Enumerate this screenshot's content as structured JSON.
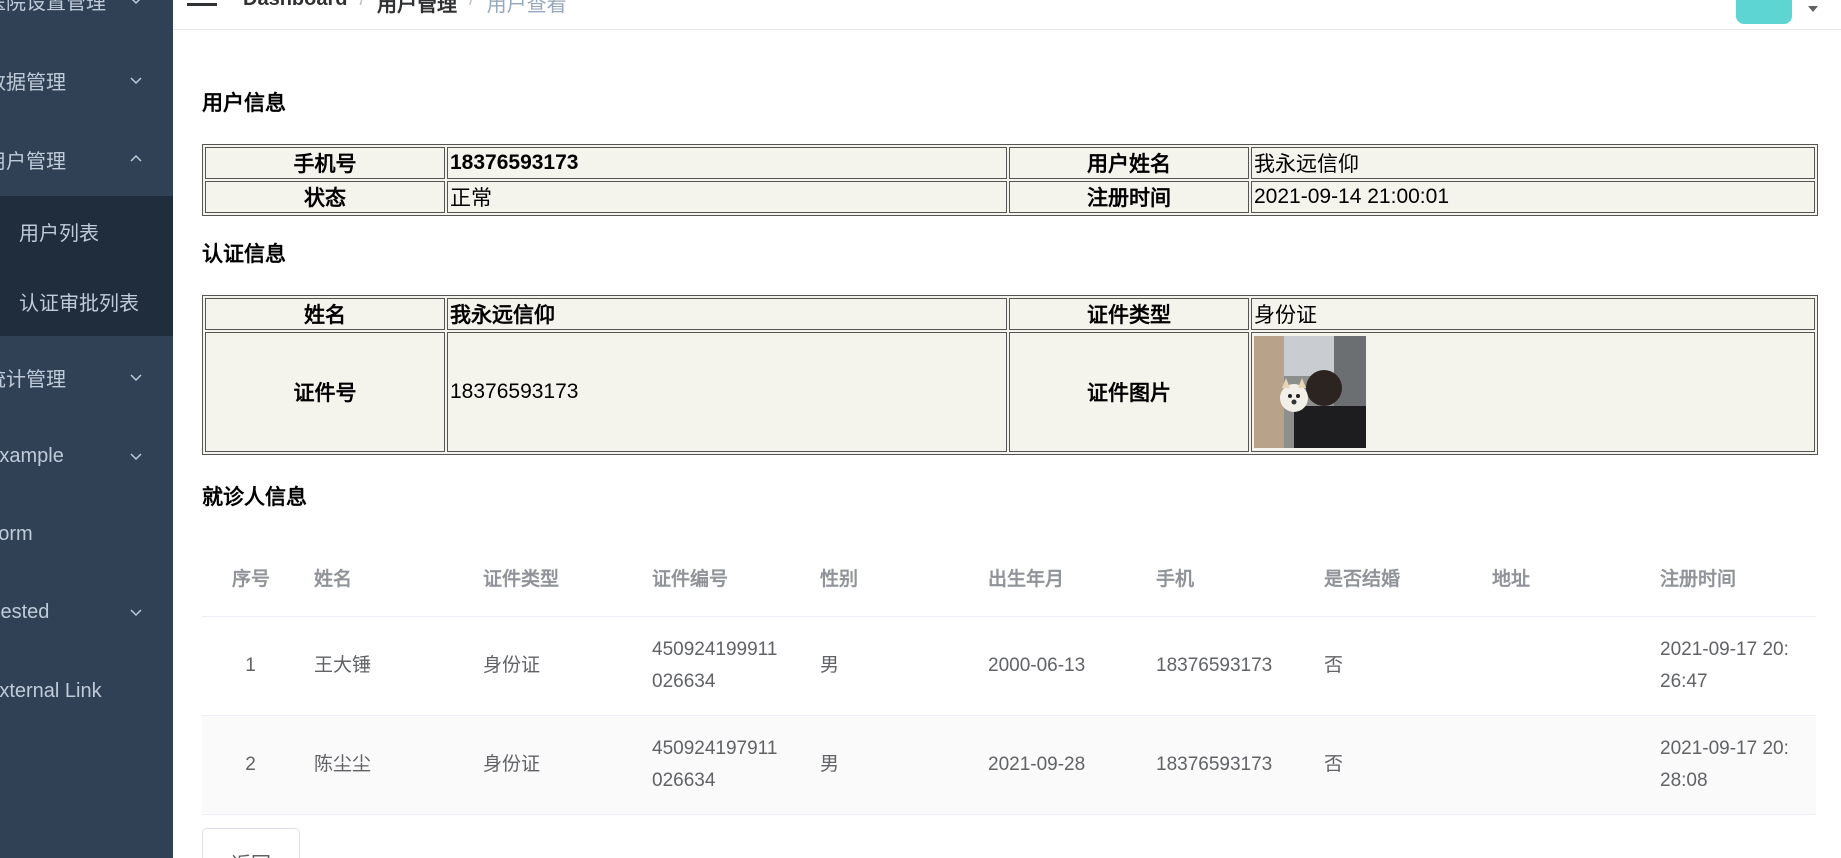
{
  "sidebar": {
    "items": [
      {
        "label": "医院设置管理",
        "expanded": false
      },
      {
        "label": "数据管理",
        "expanded": false
      },
      {
        "label": "用户管理",
        "expanded": true
      },
      {
        "label": "统计管理",
        "expanded": false
      },
      {
        "label": "Example",
        "expanded": false
      },
      {
        "label": "Form"
      },
      {
        "label": "Nested",
        "expanded": false
      },
      {
        "label": "External Link"
      }
    ],
    "sub_items": [
      {
        "label": "用户列表"
      },
      {
        "label": "认证审批列表"
      }
    ]
  },
  "navbar": {
    "breadcrumb": [
      "Dashboard",
      "用户管理",
      "用户查看"
    ]
  },
  "user_info": {
    "title": "用户信息",
    "phone_label": "手机号",
    "phone": "18376593173",
    "name_label": "用户姓名",
    "name": "我永远信仰",
    "status_label": "状态",
    "status": "正常",
    "reg_time_label": "注册时间",
    "reg_time": "2021-09-14 21:00:01"
  },
  "auth_info": {
    "title": "认证信息",
    "name_label": "姓名",
    "name": "我永远信仰",
    "cert_type_label": "证件类型",
    "cert_type": "身份证",
    "cert_no_label": "证件号",
    "cert_no": "18376593173",
    "cert_img_label": "证件图片"
  },
  "patients": {
    "title": "就诊人信息",
    "columns": [
      "序号",
      "姓名",
      "证件类型",
      "证件编号",
      "性别",
      "出生年月",
      "手机",
      "是否结婚",
      "地址",
      "注册时间"
    ],
    "rows": [
      {
        "no": "1",
        "name": "王大锤",
        "cert_type": "身份证",
        "cert_no_1": "450924199911",
        "cert_no_2": "026634",
        "sex": "男",
        "birth": "2000-06-13",
        "phone": "18376593173",
        "married": "否",
        "address": "",
        "reg_1": "2021-09-17 20:",
        "reg_2": "26:47"
      },
      {
        "no": "2",
        "name": "陈尘尘",
        "cert_type": "身份证",
        "cert_no_1": "450924197911",
        "cert_no_2": "026634",
        "sex": "男",
        "birth": "2021-09-28",
        "phone": "18376593173",
        "married": "否",
        "address": "",
        "reg_1": "2021-09-17 20:",
        "reg_2": "28:08"
      }
    ]
  },
  "back_button": {
    "label": "返回"
  },
  "colors": {
    "sidebar_bg": "#304156",
    "submenu_bg": "#1f2d3d",
    "table_bg": "#f5f4ec",
    "avatar": "#5dd6d3"
  }
}
